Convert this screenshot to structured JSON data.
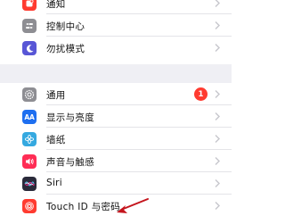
{
  "settings": {
    "top_group": [
      {
        "label": "通知",
        "icon": "notifications-icon",
        "color": "#ff3b30"
      },
      {
        "label": "控制中心",
        "icon": "control-center-icon",
        "color": "#8e8e93"
      },
      {
        "label": "勿扰模式",
        "icon": "do-not-disturb-icon",
        "color": "#5856d6"
      }
    ],
    "bottom_group": [
      {
        "label": "通用",
        "icon": "general-gear-icon",
        "color": "#8e8e93",
        "badge": "1"
      },
      {
        "label": "显示与亮度",
        "icon": "display-brightness-icon",
        "color": "#1e6ff0",
        "glyph": "AA"
      },
      {
        "label": "墙纸",
        "icon": "wallpaper-icon",
        "color": "#35a9e0"
      },
      {
        "label": "声音与触感",
        "icon": "sounds-haptics-icon",
        "color": "#ff2d55"
      },
      {
        "label": "Siri",
        "icon": "siri-icon",
        "color": "#2a2a3a"
      },
      {
        "label": "Touch ID 与密码",
        "icon": "touch-id-icon",
        "color": "#ff3b30"
      }
    ]
  },
  "annotation": {
    "arrow_color": "#c4141c",
    "icon": "pointer-arrow-icon"
  },
  "colors": {
    "chevron": "#c7c7cc",
    "group_gap": "#efeff4",
    "badge": "#ff3b30"
  }
}
